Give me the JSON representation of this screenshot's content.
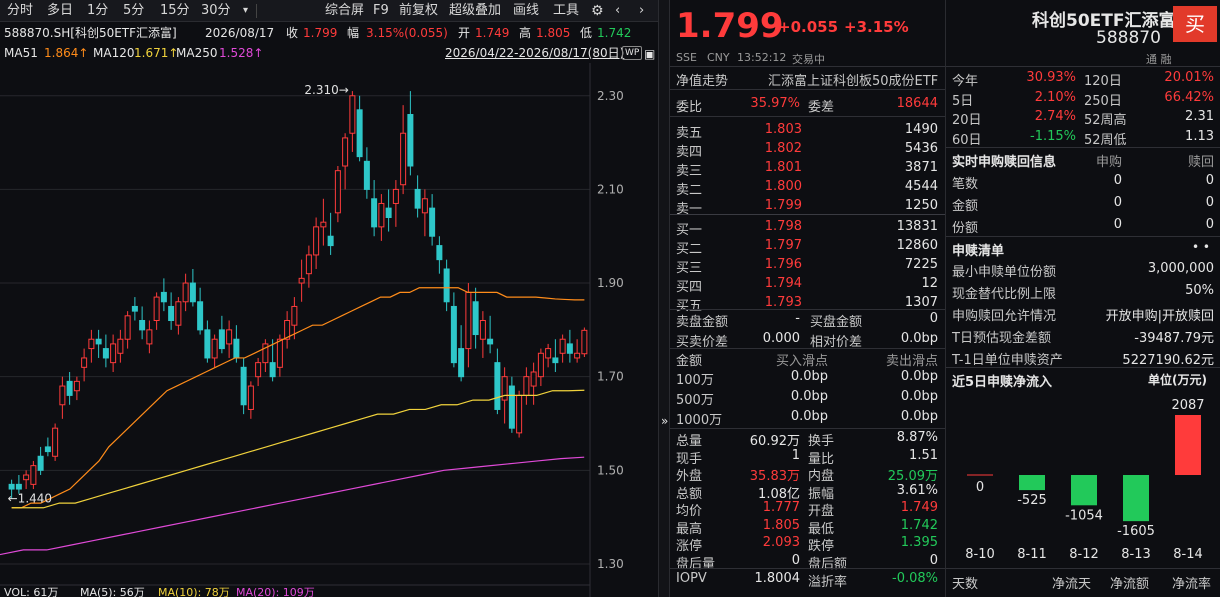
{
  "toolbar": {
    "left_tabs": [
      "分时",
      "多日",
      "1分",
      "5分",
      "15分",
      "30分"
    ],
    "more": "▾",
    "right_tabs": [
      "综合屏",
      "F9",
      "前复权",
      "超级叠加",
      "画线",
      "工具"
    ]
  },
  "info": {
    "code": "588870.SH[科创50ETF汇添富]",
    "date": "2026/08/17",
    "close_label": "收",
    "close": "1.799",
    "amp_label": "幅",
    "amp": "3.15%(0.055)",
    "open_label": "开",
    "open": "1.749",
    "high_label": "高",
    "high": "1.805",
    "low_label": "低",
    "low": "1.742"
  },
  "ma": {
    "ma51_label": "MA51",
    "ma51": "1.864↑",
    "ma120_label": "MA120",
    "ma120": "1.671↑",
    "ma250_label": "MA250",
    "ma250": "1.528↑",
    "range": "2026/04/22-2026/08/17(80日)",
    "wp": "WP"
  },
  "chart_data": {
    "type": "candlestick",
    "y_ticks": [
      "2.30",
      "2.10",
      "1.90",
      "1.70",
      "1.50",
      "1.30"
    ],
    "y_tick_values": [
      2.3,
      2.1,
      1.9,
      1.7,
      1.5,
      1.3
    ],
    "ylim": [
      1.27,
      2.37
    ],
    "high_mark": "2.310",
    "low_mark": "1.440",
    "candles": [
      [
        1.47,
        1.48,
        1.44,
        1.46
      ],
      [
        1.47,
        1.49,
        1.45,
        1.46
      ],
      [
        1.48,
        1.5,
        1.46,
        1.49
      ],
      [
        1.47,
        1.52,
        1.46,
        1.51
      ],
      [
        1.53,
        1.55,
        1.49,
        1.5
      ],
      [
        1.55,
        1.57,
        1.53,
        1.54
      ],
      [
        1.53,
        1.6,
        1.52,
        1.59
      ],
      [
        1.64,
        1.7,
        1.61,
        1.68
      ],
      [
        1.69,
        1.71,
        1.64,
        1.66
      ],
      [
        1.67,
        1.7,
        1.65,
        1.69
      ],
      [
        1.72,
        1.76,
        1.69,
        1.74
      ],
      [
        1.76,
        1.8,
        1.73,
        1.78
      ],
      [
        1.78,
        1.8,
        1.74,
        1.77
      ],
      [
        1.76,
        1.79,
        1.72,
        1.74
      ],
      [
        1.73,
        1.79,
        1.71,
        1.77
      ],
      [
        1.75,
        1.8,
        1.73,
        1.78
      ],
      [
        1.78,
        1.84,
        1.76,
        1.83
      ],
      [
        1.85,
        1.87,
        1.82,
        1.84
      ],
      [
        1.82,
        1.85,
        1.78,
        1.8
      ],
      [
        1.77,
        1.82,
        1.75,
        1.8
      ],
      [
        1.82,
        1.88,
        1.8,
        1.87
      ],
      [
        1.88,
        1.91,
        1.84,
        1.86
      ],
      [
        1.85,
        1.88,
        1.8,
        1.82
      ],
      [
        1.81,
        1.87,
        1.79,
        1.86
      ],
      [
        1.86,
        1.92,
        1.84,
        1.9
      ],
      [
        1.9,
        1.93,
        1.85,
        1.86
      ],
      [
        1.86,
        1.89,
        1.79,
        1.8
      ],
      [
        1.8,
        1.82,
        1.73,
        1.74
      ],
      [
        1.74,
        1.79,
        1.72,
        1.78
      ],
      [
        1.8,
        1.83,
        1.75,
        1.76
      ],
      [
        1.77,
        1.82,
        1.74,
        1.8
      ],
      [
        1.78,
        1.81,
        1.73,
        1.74
      ],
      [
        1.72,
        1.74,
        1.62,
        1.64
      ],
      [
        1.63,
        1.69,
        1.61,
        1.68
      ],
      [
        1.7,
        1.74,
        1.68,
        1.73
      ],
      [
        1.73,
        1.78,
        1.71,
        1.77
      ],
      [
        1.73,
        1.78,
        1.69,
        1.7
      ],
      [
        1.72,
        1.79,
        1.7,
        1.78
      ],
      [
        1.78,
        1.84,
        1.76,
        1.82
      ],
      [
        1.81,
        1.87,
        1.78,
        1.85
      ],
      [
        1.9,
        1.95,
        1.86,
        1.91
      ],
      [
        1.92,
        1.98,
        1.89,
        1.96
      ],
      [
        1.96,
        2.04,
        1.93,
        2.02
      ],
      [
        2.02,
        2.08,
        1.98,
        2.03
      ],
      [
        2.0,
        2.05,
        1.96,
        1.98
      ],
      [
        2.05,
        2.15,
        2.03,
        2.14
      ],
      [
        2.15,
        2.22,
        2.1,
        2.21
      ],
      [
        2.22,
        2.31,
        2.18,
        2.3
      ],
      [
        2.27,
        2.3,
        2.16,
        2.17
      ],
      [
        2.16,
        2.19,
        2.08,
        2.1
      ],
      [
        2.08,
        2.12,
        2.0,
        2.02
      ],
      [
        2.02,
        2.09,
        1.99,
        2.07
      ],
      [
        2.06,
        2.1,
        2.01,
        2.04
      ],
      [
        2.07,
        2.12,
        2.02,
        2.1
      ],
      [
        2.11,
        2.28,
        2.09,
        2.22
      ],
      [
        2.26,
        2.31,
        2.13,
        2.15
      ],
      [
        2.1,
        2.13,
        2.04,
        2.06
      ],
      [
        2.05,
        2.1,
        2.0,
        2.08
      ],
      [
        2.06,
        2.09,
        1.98,
        2.0
      ],
      [
        1.98,
        2.0,
        1.92,
        1.95
      ],
      [
        1.93,
        1.95,
        1.84,
        1.86
      ],
      [
        1.85,
        1.88,
        1.72,
        1.73
      ],
      [
        1.76,
        1.81,
        1.69,
        1.7
      ],
      [
        1.76,
        1.9,
        1.72,
        1.88
      ],
      [
        1.86,
        1.89,
        1.76,
        1.79
      ],
      [
        1.78,
        1.84,
        1.74,
        1.82
      ],
      [
        1.78,
        1.83,
        1.75,
        1.77
      ],
      [
        1.73,
        1.76,
        1.62,
        1.63
      ],
      [
        1.65,
        1.72,
        1.6,
        1.7
      ],
      [
        1.68,
        1.7,
        1.58,
        1.59
      ],
      [
        1.58,
        1.67,
        1.57,
        1.66
      ],
      [
        1.66,
        1.72,
        1.64,
        1.7
      ],
      [
        1.68,
        1.73,
        1.64,
        1.71
      ],
      [
        1.7,
        1.76,
        1.68,
        1.75
      ],
      [
        1.74,
        1.77,
        1.72,
        1.76
      ],
      [
        1.74,
        1.78,
        1.71,
        1.73
      ],
      [
        1.75,
        1.79,
        1.73,
        1.78
      ],
      [
        1.77,
        1.8,
        1.73,
        1.75
      ],
      [
        1.74,
        1.78,
        1.73,
        1.75
      ],
      [
        1.749,
        1.805,
        1.742,
        1.799
      ]
    ],
    "ma51": [
      1.42,
      1.42,
      1.43,
      1.43,
      1.44,
      1.45,
      1.46,
      1.48,
      1.5,
      1.52,
      1.55,
      1.57,
      1.59,
      1.61,
      1.63,
      1.65,
      1.67,
      1.68,
      1.69,
      1.7,
      1.71,
      1.72,
      1.73,
      1.74,
      1.74,
      1.75,
      1.76,
      1.77,
      1.78,
      1.79,
      1.8,
      1.81,
      1.81,
      1.82,
      1.83,
      1.84,
      1.85,
      1.86,
      1.87,
      1.87,
      1.88,
      1.88,
      1.89,
      1.89,
      1.89,
      1.89,
      1.89,
      1.88,
      1.88,
      1.88,
      1.88,
      1.87,
      1.87,
      1.87,
      1.87,
      1.868,
      1.866,
      1.865,
      1.864,
      1.864
    ],
    "ma120": [
      1.42,
      1.42,
      1.42,
      1.43,
      1.43,
      1.44,
      1.45,
      1.46,
      1.47,
      1.48,
      1.49,
      1.5,
      1.51,
      1.52,
      1.53,
      1.54,
      1.55,
      1.56,
      1.57,
      1.58,
      1.59,
      1.6,
      1.61,
      1.62,
      1.62,
      1.63,
      1.63,
      1.64,
      1.64,
      1.65,
      1.65,
      1.66,
      1.66,
      1.66,
      1.67,
      1.67,
      1.671
    ],
    "ma250": [
      1.32,
      1.33,
      1.33,
      1.34,
      1.35,
      1.36,
      1.37,
      1.38,
      1.39,
      1.4,
      1.41,
      1.42,
      1.43,
      1.44,
      1.45,
      1.46,
      1.47,
      1.48,
      1.49,
      1.5,
      1.505,
      1.51,
      1.515,
      1.52,
      1.525,
      1.528
    ],
    "vol_bar": {
      "label": "VOL: 61万",
      "ma5": "MA(5): 56万",
      "ma10": "MA(10): 78万",
      "ma20": "MA(20): 109万"
    }
  },
  "quote": {
    "price": "1.799",
    "chg": "+0.055",
    "pct": "+3.15%",
    "exch": "SSE",
    "cur": "CNY",
    "time": "13:52:12",
    "status": "交易中"
  },
  "security": {
    "name": "科创50ETF汇添富",
    "code": "588870",
    "buy": "买",
    "tags": "通  融"
  },
  "nav": {
    "label": "净值走势",
    "full_name": "汇添富上证科创板50成份ETF"
  },
  "wb": {
    "l1": "委比",
    "v1": "35.97%",
    "l2": "委差",
    "v2": "18644"
  },
  "sells": [
    {
      "n": "卖五",
      "p": "1.803",
      "v": "1490"
    },
    {
      "n": "卖四",
      "p": "1.802",
      "v": "5436"
    },
    {
      "n": "卖三",
      "p": "1.801",
      "v": "3871"
    },
    {
      "n": "卖二",
      "p": "1.800",
      "v": "4544"
    },
    {
      "n": "卖一",
      "p": "1.799",
      "v": "1250"
    }
  ],
  "buys": [
    {
      "n": "买一",
      "p": "1.798",
      "v": "13831"
    },
    {
      "n": "买二",
      "p": "1.797",
      "v": "12860"
    },
    {
      "n": "买三",
      "p": "1.796",
      "v": "7225"
    },
    {
      "n": "买四",
      "p": "1.794",
      "v": "12"
    },
    {
      "n": "买五",
      "p": "1.793",
      "v": "1307"
    }
  ],
  "amt": {
    "l1": "卖盘金额",
    "v1": "-",
    "l2": "买盘金额",
    "v2": "0",
    "l3": "买卖价差",
    "v3": "0.000",
    "l4": "相对价差",
    "v4": "0.0bp"
  },
  "slip": {
    "h0": "金额",
    "h1": "买入滑点",
    "h2": "卖出滑点",
    "rows": [
      {
        "a": "100万",
        "b": "0.0bp",
        "s": "0.0bp"
      },
      {
        "a": "500万",
        "b": "0.0bp",
        "s": "0.0bp"
      },
      {
        "a": "1000万",
        "b": "0.0bp",
        "s": "0.0bp"
      }
    ]
  },
  "stats": [
    {
      "l": "总量",
      "v": "60.92万",
      "vc": "w",
      "l2": "换手",
      "v2": "8.87%",
      "v2c": "w"
    },
    {
      "l": "现手",
      "v": "1",
      "vc": "w",
      "l2": "量比",
      "v2": "1.51",
      "v2c": "w"
    },
    {
      "l": "外盘",
      "v": "35.83万",
      "vc": "r",
      "l2": "内盘",
      "v2": "25.09万",
      "v2c": "g"
    },
    {
      "l": "总额",
      "v": "1.08亿",
      "vc": "w",
      "l2": "振幅",
      "v2": "3.61%",
      "v2c": "w"
    },
    {
      "l": "均价",
      "v": "1.777",
      "vc": "r",
      "l2": "开盘",
      "v2": "1.749",
      "v2c": "r"
    },
    {
      "l": "最高",
      "v": "1.805",
      "vc": "r",
      "l2": "最低",
      "v2": "1.742",
      "v2c": "g"
    },
    {
      "l": "涨停",
      "v": "2.093",
      "vc": "r",
      "l2": "跌停",
      "v2": "1.395",
      "v2c": "g"
    },
    {
      "l": "盘后量",
      "v": "0",
      "vc": "w",
      "l2": "盘后额",
      "v2": "0",
      "v2c": "w"
    },
    {
      "l": "IOPV",
      "v": "1.8004",
      "vc": "w",
      "l2": "溢折率",
      "v2": "-0.08%",
      "v2c": "g"
    }
  ],
  "perf": [
    {
      "l": "今年",
      "v": "30.93%",
      "vc": "r",
      "l2": "120日",
      "v2": "20.01%",
      "v2c": "r"
    },
    {
      "l": "5日",
      "v": "2.10%",
      "vc": "r",
      "l2": "250日",
      "v2": "66.42%",
      "v2c": "r"
    },
    {
      "l": "20日",
      "v": "2.74%",
      "vc": "r",
      "l2": "52周高",
      "v2": "2.31",
      "v2c": "w"
    },
    {
      "l": "60日",
      "v": "-1.15%",
      "vc": "g",
      "l2": "52周低",
      "v2": "1.13",
      "v2c": "w"
    }
  ],
  "sub": {
    "title": "实时申购赎回信息",
    "h1": "申购",
    "h2": "赎回",
    "rows": [
      {
        "l": "笔数",
        "a": "0",
        "b": "0"
      },
      {
        "l": "金额",
        "a": "0",
        "b": "0"
      },
      {
        "l": "份额",
        "a": "0",
        "b": "0"
      }
    ]
  },
  "list": {
    "title": "申赎清单",
    "more": "• •",
    "rows": [
      {
        "l": "最小申赎单位份额",
        "v": "3,000,000"
      },
      {
        "l": "现金替代比例上限",
        "v": "50%"
      },
      {
        "l": "申购赎回允许情况",
        "v": "开放申购|开放赎回"
      },
      {
        "l": "T日预估现金差额",
        "v": "-39487.79元"
      },
      {
        "l": "T-1日单位申赎资产",
        "v": "5227190.62元"
      }
    ]
  },
  "flow": {
    "title": "近5日申赎净流入",
    "unit": "单位(万元)",
    "days": [
      "8-10",
      "8-11",
      "8-12",
      "8-13",
      "8-14"
    ],
    "values": [
      0,
      -525,
      -1054,
      -1605,
      2087
    ],
    "labels": [
      "0",
      "-525",
      "-1054",
      "-1605",
      "2087"
    ]
  },
  "bottom": {
    "h0": "天数",
    "h1": "净流天",
    "h2": "净流额",
    "h3": "净流率"
  },
  "arrow": "»"
}
